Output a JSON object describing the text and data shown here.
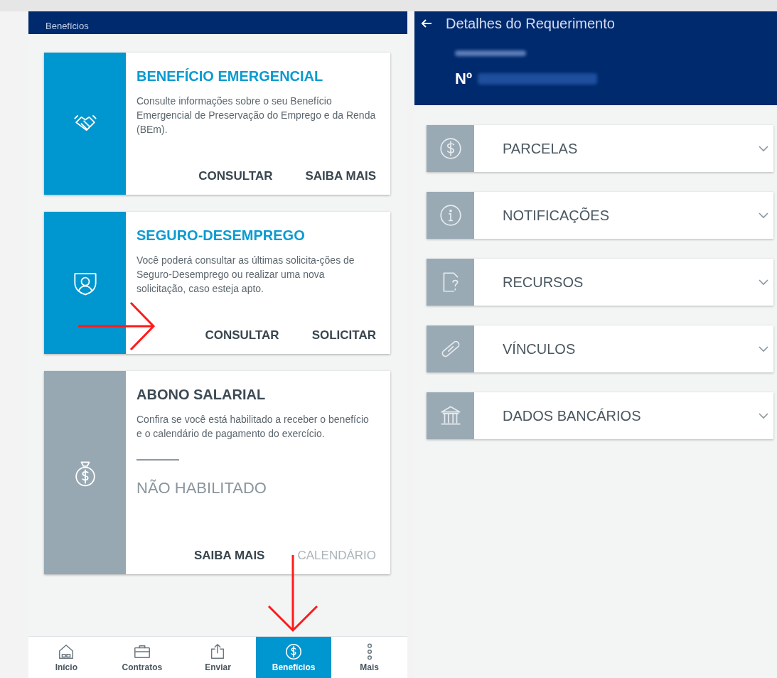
{
  "left_screen": {
    "header_title": "Benefícios",
    "cards": [
      {
        "kind": "handshake",
        "active": true,
        "title": "BENEFÍCIO EMERGENCIAL",
        "text": "Consulte informações sobre o seu Benefício Emergencial de Preservação do Emprego e da Renda (BEm).",
        "actions": [
          {
            "label": "CONSULTAR",
            "disabled": false
          },
          {
            "label": "SAIBA MAIS",
            "disabled": false
          }
        ]
      },
      {
        "kind": "shield",
        "active": true,
        "title": "SEGURO-DESEMPREGO",
        "text": "Você poderá consultar as últimas solicita-ções de Seguro-Desemprego ou realizar uma nova solicitação, caso esteja apto.",
        "actions": [
          {
            "label": "CONSULTAR",
            "disabled": false
          },
          {
            "label": "SOLICITAR",
            "disabled": false
          }
        ]
      },
      {
        "kind": "money-bag",
        "active": false,
        "title": "ABONO SALARIAL",
        "text": "Confira se você está habilitado a receber o benefício e o calendário de pagamento do exercício.",
        "status": "NÃO HABILITADO",
        "actions": [
          {
            "label": "SAIBA MAIS",
            "disabled": false
          },
          {
            "label": "CALENDÁRIO",
            "disabled": true
          }
        ]
      }
    ],
    "bottom_nav": [
      {
        "kind": "home",
        "label": "Início",
        "selected": false
      },
      {
        "kind": "briefcase",
        "label": "Contratos",
        "selected": false
      },
      {
        "kind": "upload",
        "label": "Enviar",
        "selected": false
      },
      {
        "kind": "dollar",
        "label": "Benefícios",
        "selected": true
      },
      {
        "kind": "more",
        "label": "Mais",
        "selected": false
      }
    ]
  },
  "right_screen": {
    "header_title": "Detalhes do Requerimento",
    "number_label": "Nº",
    "sections": [
      {
        "kind": "dollar",
        "label": "PARCELAS",
        "expanded": false
      },
      {
        "kind": "info",
        "label": "NOTIFICAÇÕES",
        "expanded": false
      },
      {
        "kind": "doc-question",
        "label": "RECURSOS",
        "expanded": false
      },
      {
        "kind": "link",
        "label": "VÍNCULOS",
        "expanded": false
      },
      {
        "kind": "bank",
        "label": "DADOS BANCÁRIOS",
        "expanded": false
      }
    ]
  }
}
